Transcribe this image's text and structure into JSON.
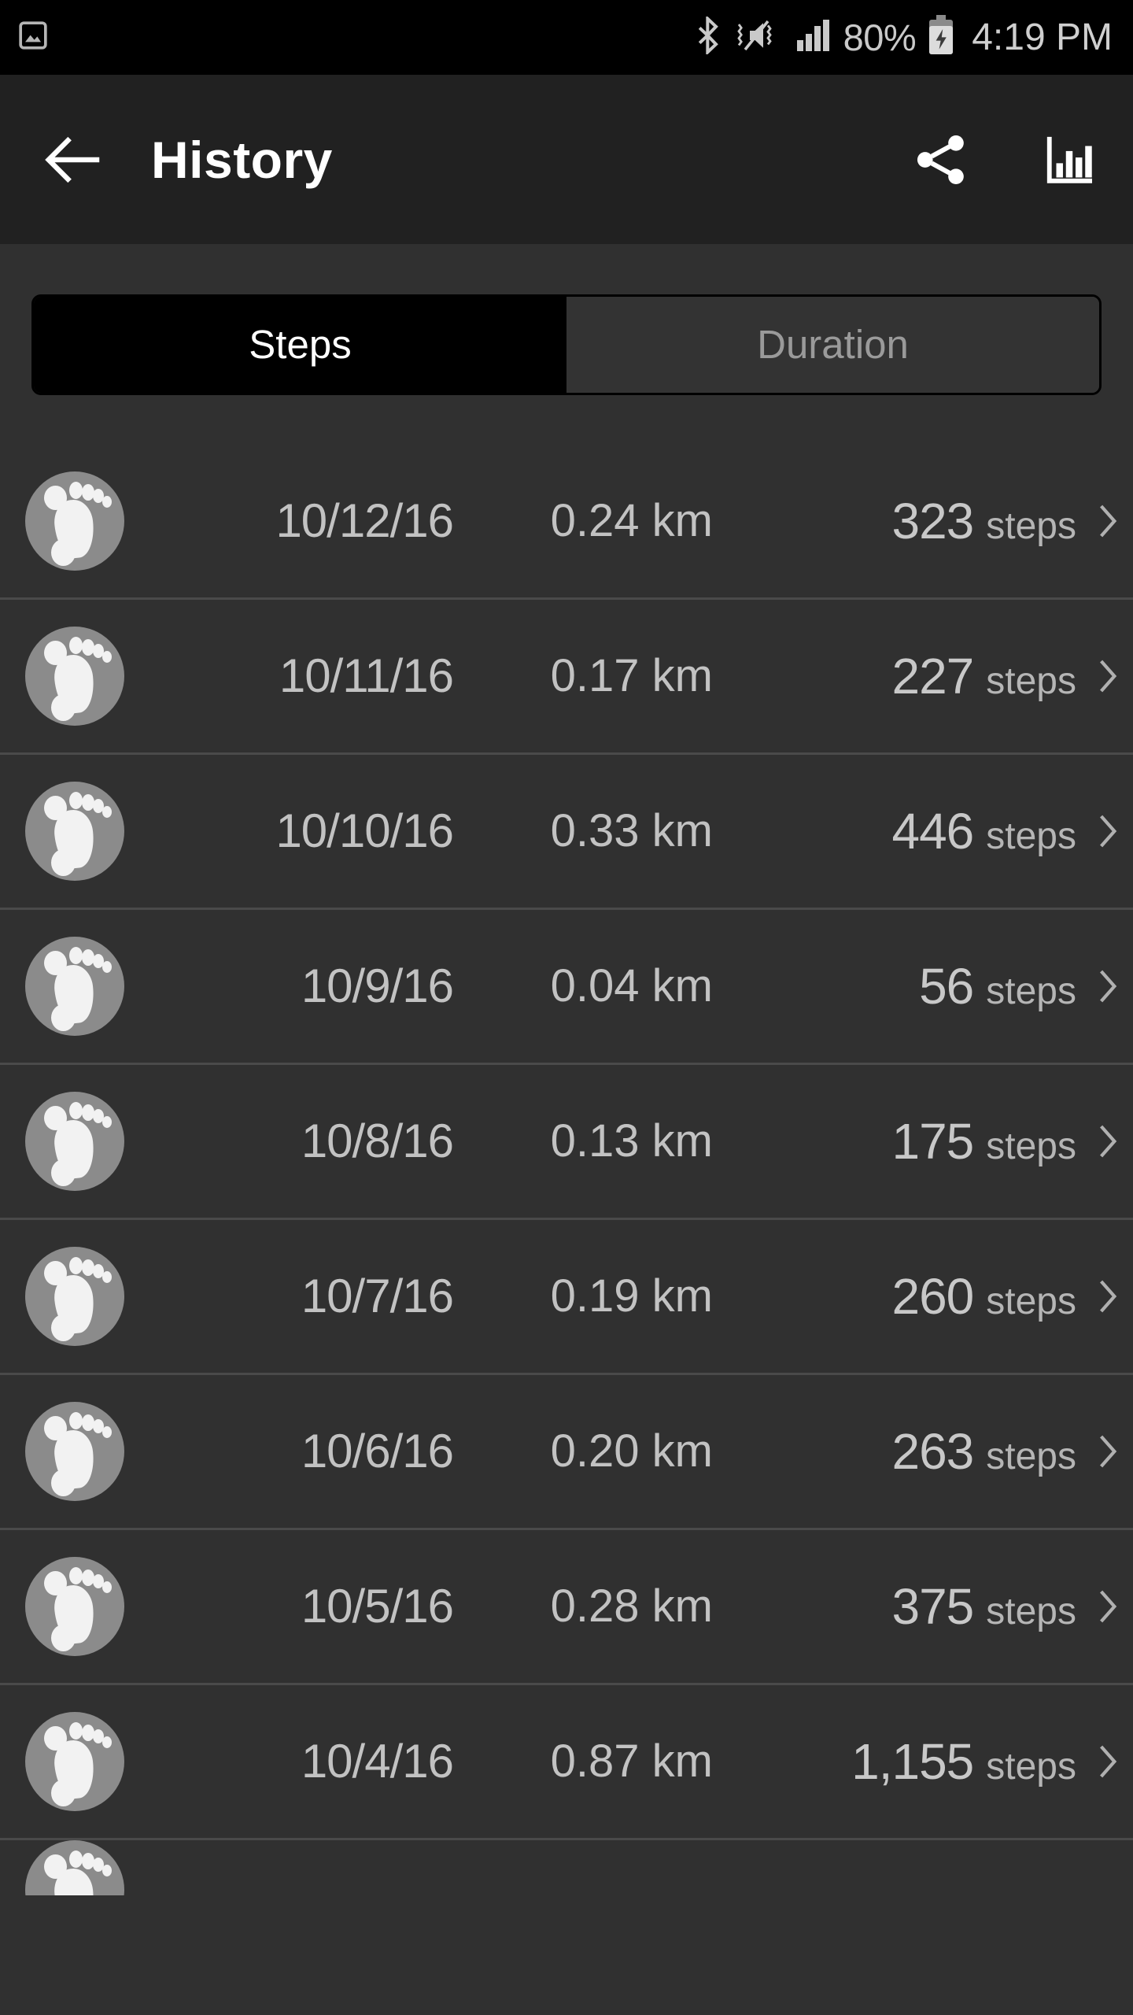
{
  "status_bar": {
    "left_icons": [
      "screenshot-image-icon"
    ],
    "right_icons": [
      "bluetooth-icon",
      "volume-mute-vibrate-icon",
      "cellular-signal-icon",
      "battery-charging-icon"
    ],
    "battery_percent": "80%",
    "clock": "4:19 PM"
  },
  "app_bar": {
    "back_icon": "arrow-back-icon",
    "title": "History",
    "actions": [
      {
        "icon": "share-icon",
        "name": "share-button"
      },
      {
        "icon": "bar-chart-icon",
        "name": "chart-button"
      }
    ]
  },
  "tabs": {
    "selected_index": 0,
    "items": [
      {
        "label": "Steps",
        "selected": true
      },
      {
        "label": "Duration",
        "selected": false
      }
    ]
  },
  "list": {
    "unit_label": "steps",
    "chevron_icon": "chevron-right-icon",
    "avatar_icon": "footprint-icon",
    "rows": [
      {
        "date": "10/12/16",
        "distance": "0.24 km",
        "steps": "323"
      },
      {
        "date": "10/11/16",
        "distance": "0.17 km",
        "steps": "227"
      },
      {
        "date": "10/10/16",
        "distance": "0.33 km",
        "steps": "446"
      },
      {
        "date": "10/9/16",
        "distance": "0.04 km",
        "steps": "56"
      },
      {
        "date": "10/8/16",
        "distance": "0.13 km",
        "steps": "175"
      },
      {
        "date": "10/7/16",
        "distance": "0.19 km",
        "steps": "260"
      },
      {
        "date": "10/6/16",
        "distance": "0.20 km",
        "steps": "263"
      },
      {
        "date": "10/5/16",
        "distance": "0.28 km",
        "steps": "375"
      },
      {
        "date": "10/4/16",
        "distance": "0.87 km",
        "steps": "1,155"
      }
    ]
  },
  "colors": {
    "status_bar_bg": "#000000",
    "app_bar_bg": "#212121",
    "page_bg": "#303030",
    "tab_selected_bg": "#000000",
    "tab_unselected_bg": "#333333",
    "divider": "#4a4a4a",
    "primary_text": "#ffffff",
    "secondary_text": "#c2c2c2",
    "muted_text": "#9a9a9a",
    "avatar_bg": "#8b8b8b"
  }
}
